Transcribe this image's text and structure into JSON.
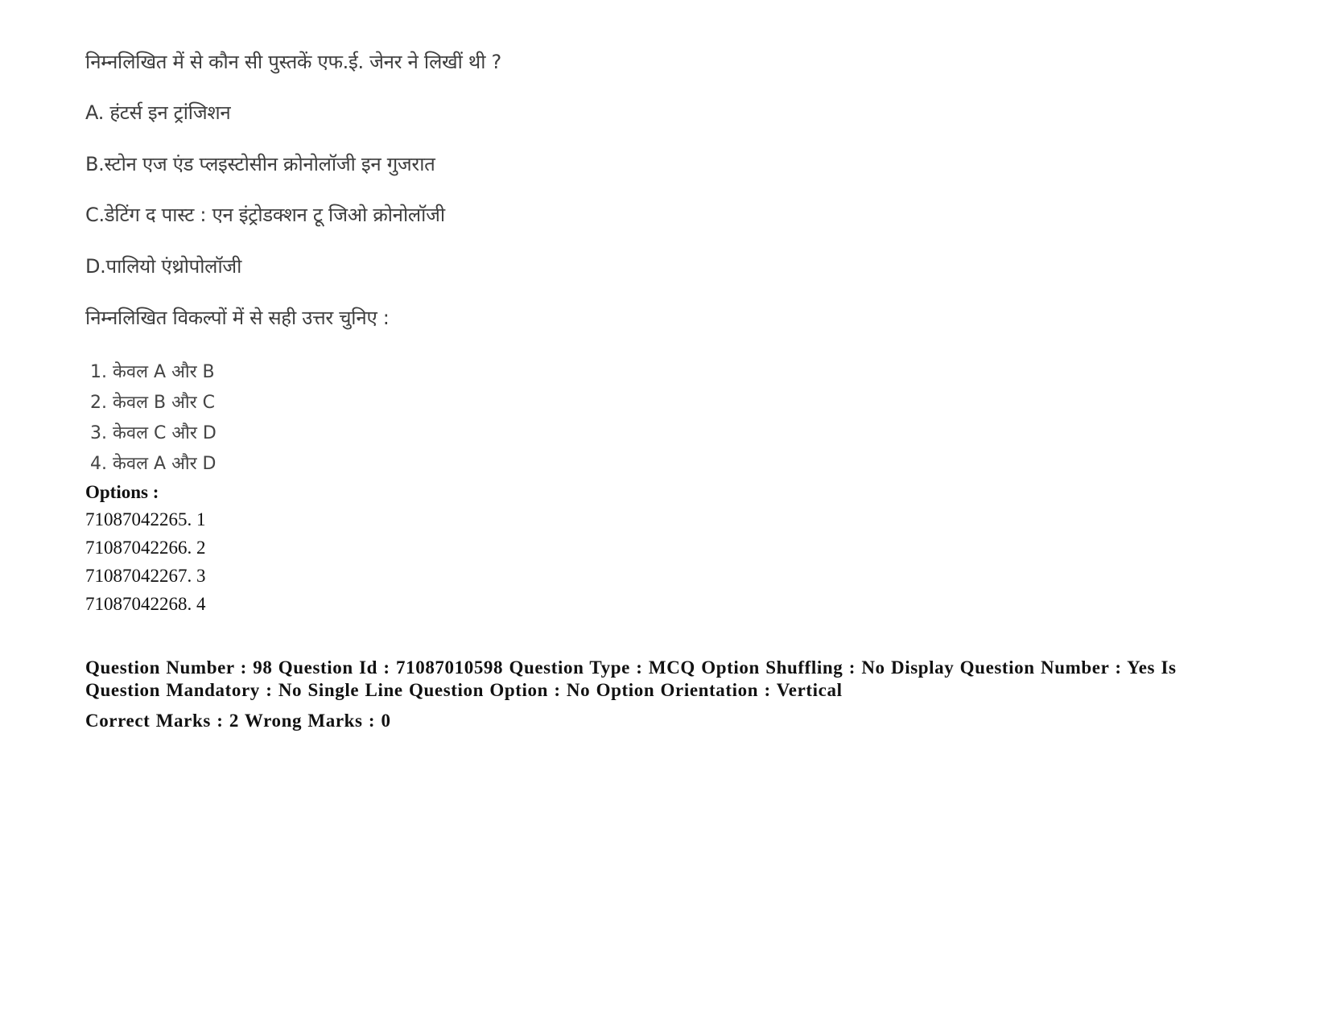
{
  "question": {
    "stem": "निम्नलिखित में से कौन सी पुस्तकें एफ.ई. जेनर ने लिखीं थी ?",
    "statements": [
      "A. हंटर्स इन ट्रांजिशन",
      "B.स्टोन एज एंड प्लइस्टोसीन क्रोनोलॉजी इन गुजरात",
      "C.डेटिंग द पास्ट : एन इंट्रोडक्शन टू जिओ क्रोनोलॉजी",
      "D.पालियो एंथ्रोपोलॉजी"
    ],
    "instruction": "निम्नलिखित विकल्पों में से सही उत्तर चुनिए :",
    "choices": [
      "1. केवल A और B",
      "2. केवल B और C",
      "3. केवल C और D",
      "4. केवल A और D"
    ]
  },
  "options": {
    "label": "Options :",
    "items": [
      "71087042265. 1",
      "71087042266. 2",
      "71087042267. 3",
      "71087042268. 4"
    ]
  },
  "next_question_meta": {
    "line": "Question Number : 98 Question Id : 71087010598 Question Type : MCQ Option Shuffling : No Display Question Number : Yes Is Question Mandatory : No Single Line Question Option : No Option Orientation : Vertical",
    "marks": "Correct Marks : 2 Wrong Marks : 0"
  }
}
